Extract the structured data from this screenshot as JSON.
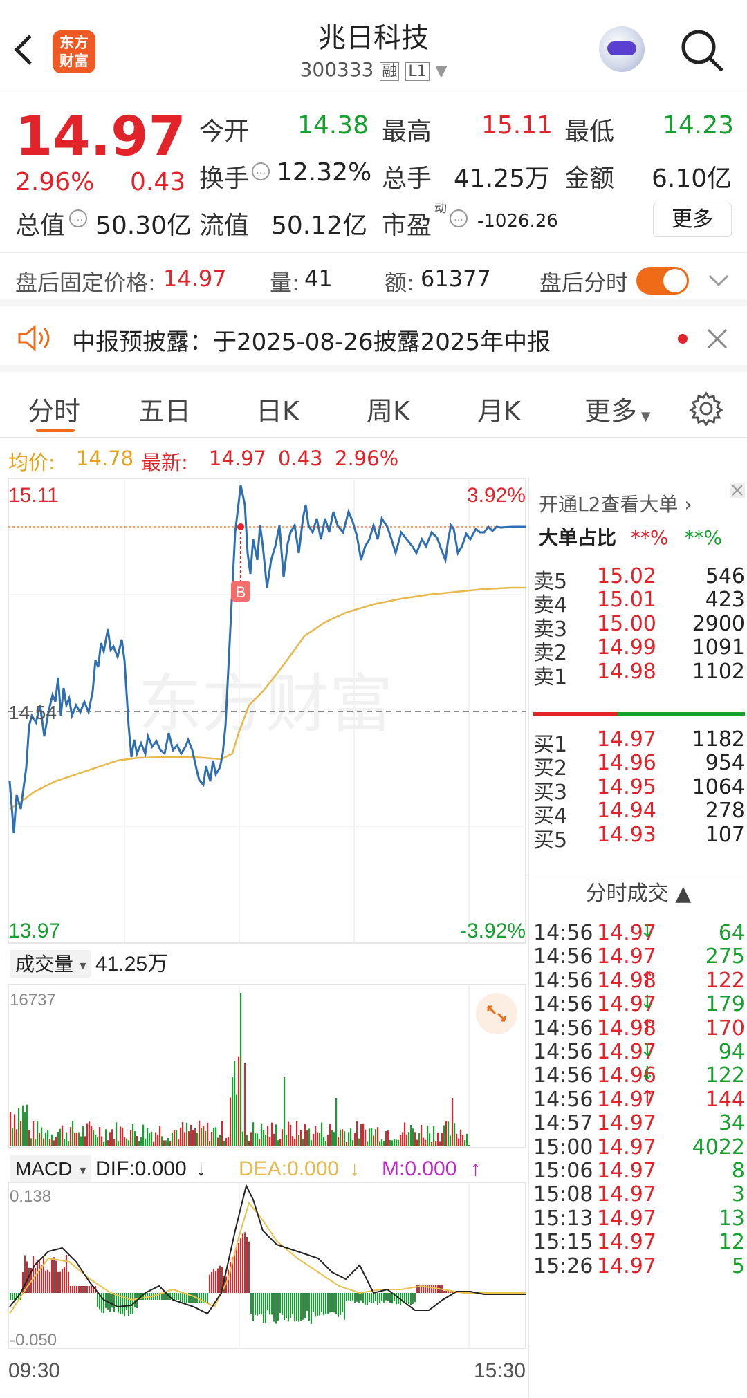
{
  "header": {
    "title": "兆日科技",
    "code": "300333",
    "badge_rong": "融",
    "badge_l1": "L1",
    "logo_text_1": "东方",
    "logo_text_2": "财富"
  },
  "quote": {
    "price": "14.97",
    "change_pct": "2.96%",
    "change": "0.43",
    "open_label": "今开",
    "open": "14.38",
    "high_label": "最高",
    "high": "15.11",
    "low_label": "最低",
    "low": "14.23",
    "turnover_label": "换手",
    "turnover": "12.32%",
    "volume_label": "总手",
    "volume": "41.25万",
    "amount_label": "金额",
    "amount": "6.10亿",
    "mktcap_label": "总值",
    "mktcap": "50.30亿",
    "float_label": "流值",
    "float_cap": "50.12亿",
    "pe_label": "市盈",
    "pe_sup": "动",
    "pe": "-1026.26",
    "more_button": "更多"
  },
  "after_hours": {
    "price_label": "盘后固定价格:",
    "price": "14.97",
    "vol_label": "量:",
    "vol": "41",
    "amt_label": "额:",
    "amt": "61377",
    "toggle_label": "盘后分时"
  },
  "notice": {
    "text": "中报预披露：于2025-08-26披露2025年中报"
  },
  "tabs": [
    "分时",
    "五日",
    "日K",
    "周K",
    "月K",
    "更多"
  ],
  "legend": {
    "avg_label": "均价:",
    "avg": "14.78",
    "latest_label": "最新:",
    "latest": "14.97",
    "chg": "0.43",
    "pct": "2.96%"
  },
  "chart": {
    "y_high": "15.11",
    "y_low": "13.97",
    "pct_high": "3.92%",
    "pct_low": "-3.92%",
    "y_mid": "14.54",
    "marker": "B",
    "watermark": "东方财富",
    "volume_label": "成交量",
    "volume_total": "41.25万",
    "volume_max": "16737",
    "macd_label": "MACD",
    "dif": "DIF:0.000",
    "dea": "DEA:0.000",
    "m": "M:0.000",
    "macd_max": "0.138",
    "macd_min": "-0.050",
    "time_start": "09:30",
    "time_end": "15:30"
  },
  "chart_data": {
    "type": "line",
    "title": "",
    "x": [
      "09:30",
      "15:30"
    ],
    "ylim": [
      13.97,
      15.11
    ],
    "prev_close": 14.54,
    "last": 14.97,
    "avg": 14.78
  },
  "book": {
    "l2_label": "开通L2查看大单",
    "big_label": "大单占比",
    "big_red": "**%",
    "big_green": "**%",
    "asks": [
      {
        "l": "卖5",
        "p": "15.02",
        "v": "546"
      },
      {
        "l": "卖4",
        "p": "15.01",
        "v": "423"
      },
      {
        "l": "卖3",
        "p": "15.00",
        "v": "2900"
      },
      {
        "l": "卖2",
        "p": "14.99",
        "v": "1091"
      },
      {
        "l": "卖1",
        "p": "14.98",
        "v": "1102"
      }
    ],
    "bids": [
      {
        "l": "买1",
        "p": "14.97",
        "v": "1182"
      },
      {
        "l": "买2",
        "p": "14.96",
        "v": "954"
      },
      {
        "l": "买3",
        "p": "14.95",
        "v": "1064"
      },
      {
        "l": "买4",
        "p": "14.94",
        "v": "278"
      },
      {
        "l": "买5",
        "p": "14.93",
        "v": "107"
      }
    ],
    "trades_label": "分时成交",
    "trades": [
      {
        "t": "14:56",
        "p": "14.97",
        "a": "↓",
        "v": "64",
        "c": "green"
      },
      {
        "t": "14:56",
        "p": "14.97",
        "a": "",
        "v": "275",
        "c": "green"
      },
      {
        "t": "14:56",
        "p": "14.98",
        "a": "↑",
        "v": "122",
        "c": "red"
      },
      {
        "t": "14:56",
        "p": "14.97",
        "a": "↓",
        "v": "179",
        "c": "green"
      },
      {
        "t": "14:56",
        "p": "14.98",
        "a": "↑",
        "v": "170",
        "c": "red"
      },
      {
        "t": "14:56",
        "p": "14.97",
        "a": "↓",
        "v": "94",
        "c": "green"
      },
      {
        "t": "14:56",
        "p": "14.96",
        "a": "↓",
        "v": "122",
        "c": "green"
      },
      {
        "t": "14:56",
        "p": "14.97",
        "a": "↑",
        "v": "144",
        "c": "red"
      },
      {
        "t": "14:57",
        "p": "14.97",
        "a": "",
        "v": "34",
        "c": "green"
      },
      {
        "t": "15:00",
        "p": "14.97",
        "a": "",
        "v": "4022",
        "c": "green"
      },
      {
        "t": "15:06",
        "p": "14.97",
        "a": "",
        "v": "8",
        "c": "green"
      },
      {
        "t": "15:08",
        "p": "14.97",
        "a": "",
        "v": "3",
        "c": "green"
      },
      {
        "t": "15:13",
        "p": "14.97",
        "a": "",
        "v": "13",
        "c": "green"
      },
      {
        "t": "15:15",
        "p": "14.97",
        "a": "",
        "v": "12",
        "c": "green"
      },
      {
        "t": "15:26",
        "p": "14.97",
        "a": "",
        "v": "5",
        "c": "green"
      }
    ]
  },
  "colors": {
    "up": "#e2232a",
    "down": "#16a12e",
    "accent": "#ef6b18",
    "price_line": "#2e6fb3",
    "avg_line": "#e8b84a"
  }
}
